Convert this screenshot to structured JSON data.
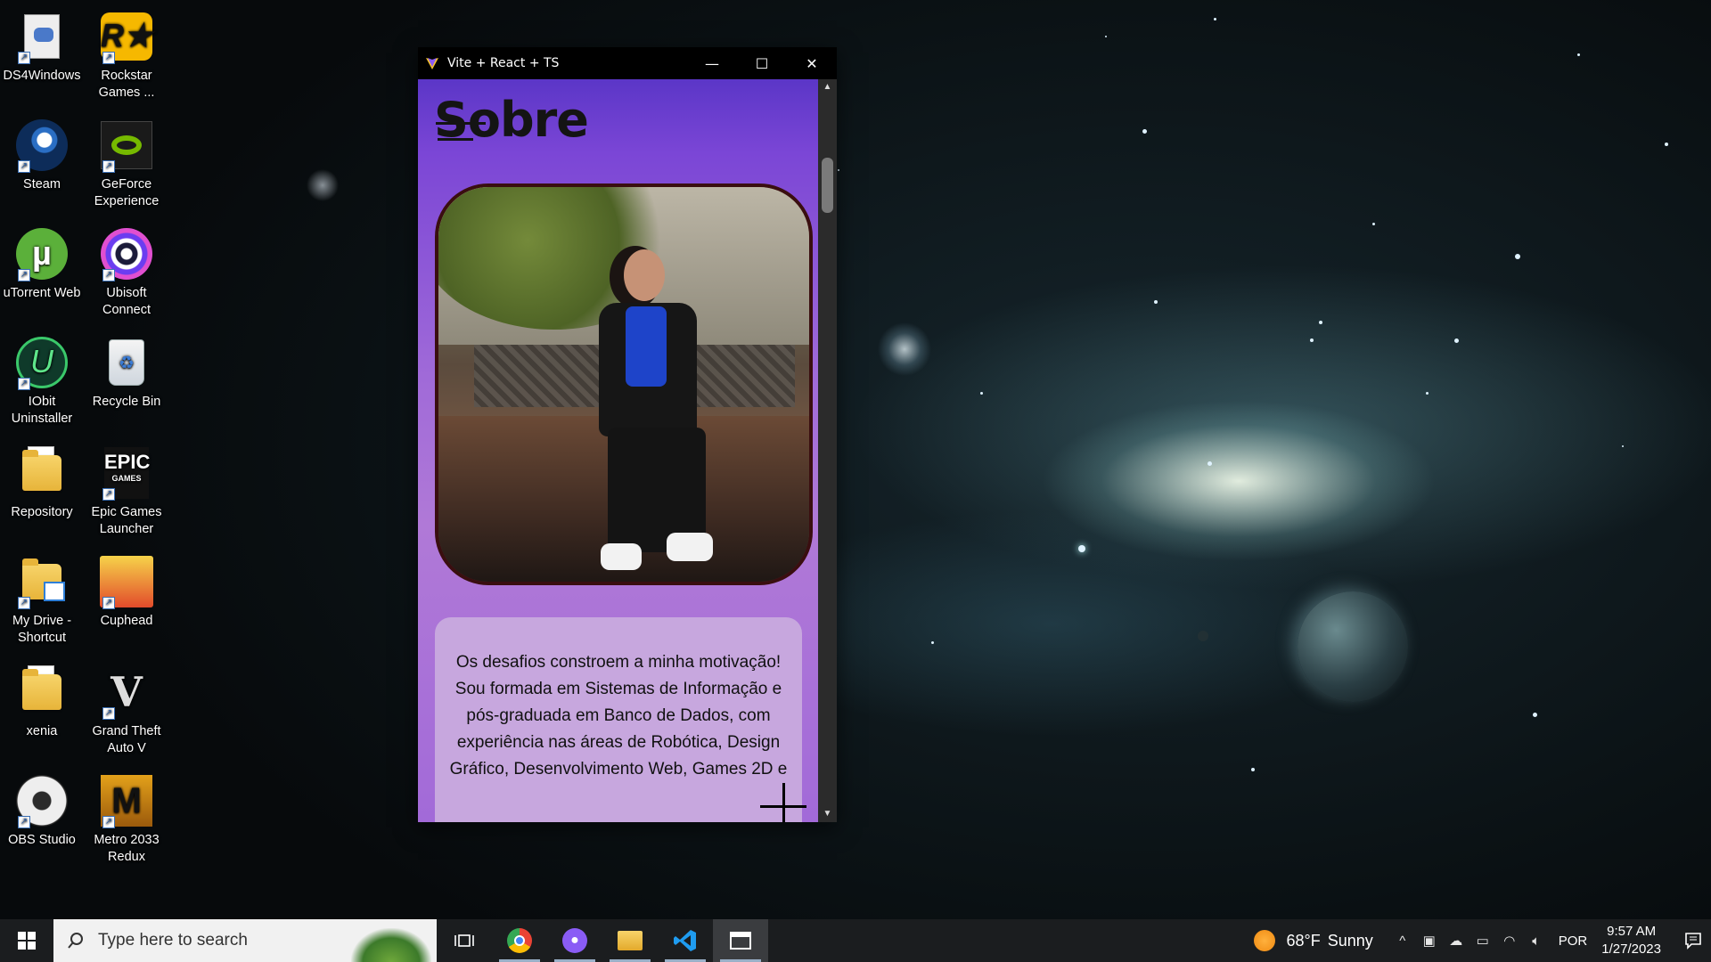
{
  "desktop": {
    "icons": [
      {
        "label": "DS4Windows"
      },
      {
        "label": "Rockstar Games ..."
      },
      {
        "label": "Steam"
      },
      {
        "label": "GeForce Experience"
      },
      {
        "label": "uTorrent Web"
      },
      {
        "label": "Ubisoft Connect"
      },
      {
        "label": "IObit Uninstaller"
      },
      {
        "label": "Recycle Bin"
      },
      {
        "label": "Repository"
      },
      {
        "label": "Epic Games Launcher"
      },
      {
        "label": "My Drive - Shortcut"
      },
      {
        "label": "Cuphead"
      },
      {
        "label": "xenia"
      },
      {
        "label": "Grand Theft Auto V"
      },
      {
        "label": "OBS Studio"
      },
      {
        "label": "Metro 2033 Redux"
      }
    ]
  },
  "window": {
    "title": "Vite + React + TS",
    "controls": {
      "minimize": "—",
      "maximize": "☐",
      "close": "✕"
    }
  },
  "page": {
    "heading": "Sobre",
    "bio": "Os desafios constroem a minha motivação! Sou formada em Sistemas de Informação e pós-graduada em Banco de Dados, com experiência nas áreas de Robótica, Design Gráfico, Desenvolvimento Web, Games 2D e"
  },
  "taskbar": {
    "search_placeholder": "Type here to search",
    "apps": [
      "task-view",
      "chrome",
      "github-desktop",
      "file-explorer",
      "vscode",
      "app-window"
    ],
    "weather": {
      "temp": "68°F",
      "condition": "Sunny"
    },
    "language": "POR",
    "time": "9:57 AM",
    "date": "1/27/2023"
  }
}
